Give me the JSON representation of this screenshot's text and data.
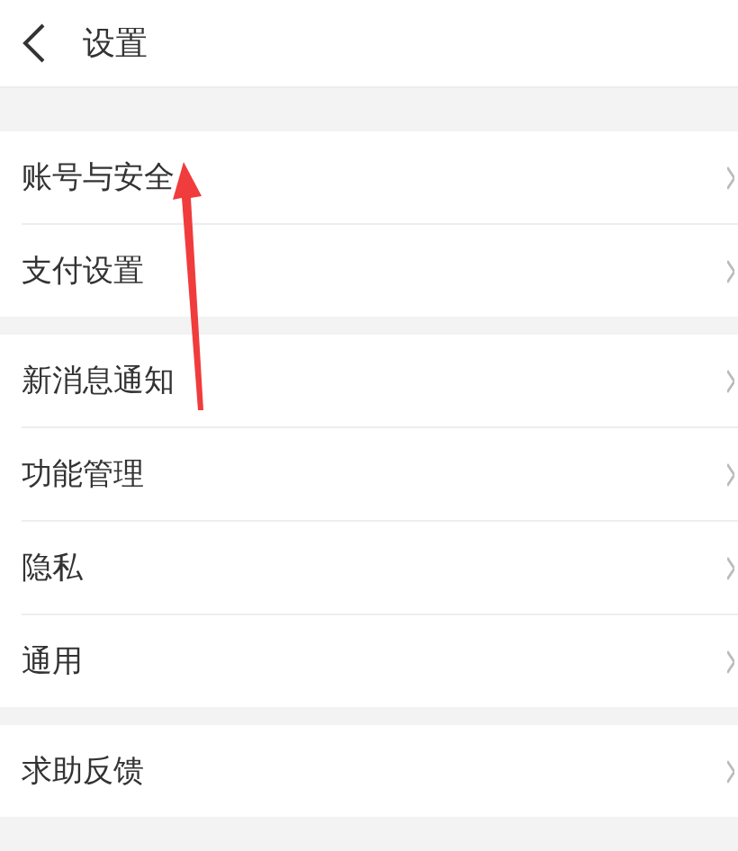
{
  "header": {
    "title": "设置"
  },
  "sections": [
    {
      "items": [
        {
          "label": "账号与安全"
        },
        {
          "label": "支付设置"
        }
      ]
    },
    {
      "items": [
        {
          "label": "新消息通知"
        },
        {
          "label": "功能管理"
        },
        {
          "label": "隐私"
        },
        {
          "label": "通用"
        }
      ]
    },
    {
      "items": [
        {
          "label": "求助反馈"
        }
      ]
    }
  ]
}
